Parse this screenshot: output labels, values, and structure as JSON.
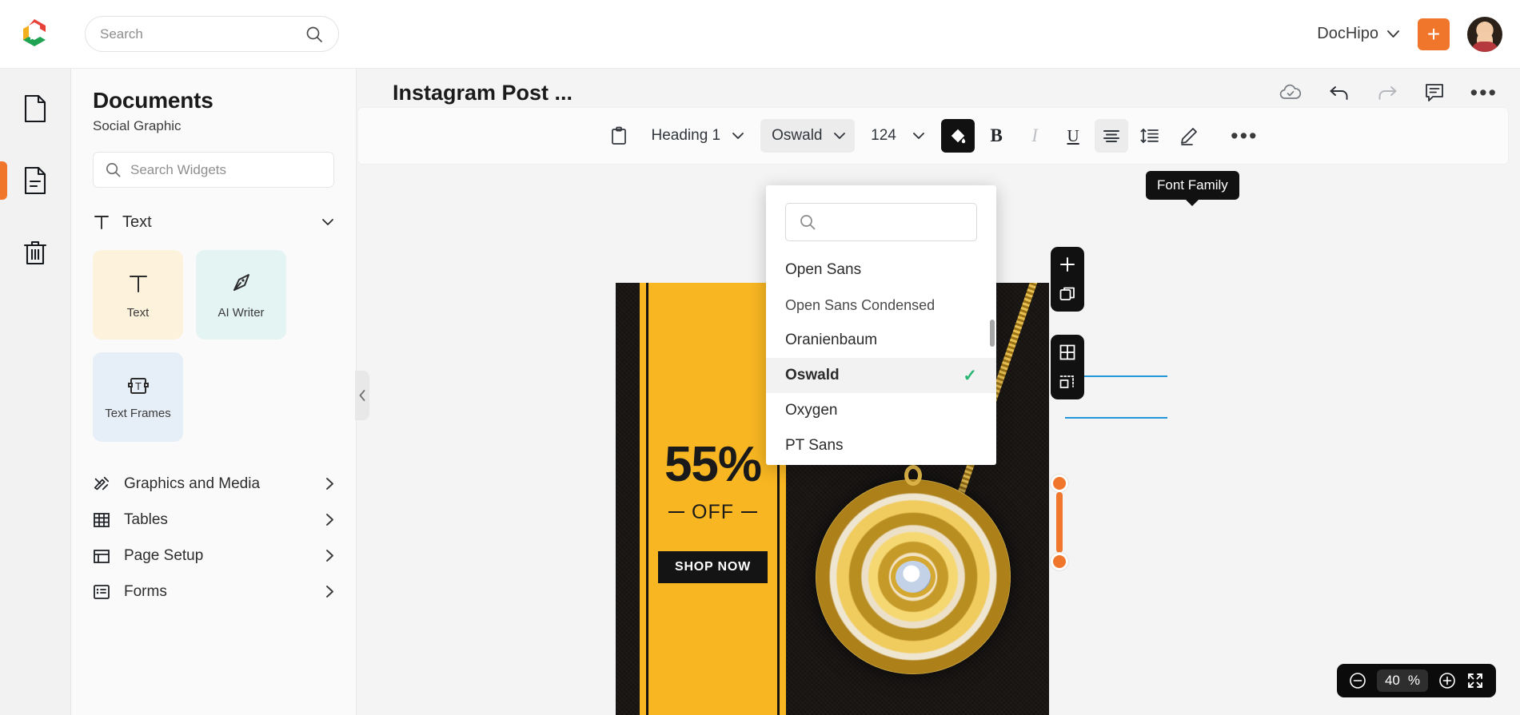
{
  "topbar": {
    "search_placeholder": "Search",
    "workspace": "DocHipo",
    "add_label": "+"
  },
  "rail": {
    "items": [
      {
        "name": "documents",
        "icon": "file-icon"
      },
      {
        "name": "templates",
        "icon": "file-lines-icon"
      },
      {
        "name": "trash",
        "icon": "trash-icon"
      }
    ]
  },
  "sidebar": {
    "title": "Documents",
    "subtitle": "Social Graphic",
    "search_placeholder": "Search Widgets",
    "section": {
      "label": "Text",
      "icon": "text-icon"
    },
    "cards": [
      {
        "label": "Text",
        "icon": "text-glyph-icon",
        "color": "#fdf3dd"
      },
      {
        "label": "AI Writer",
        "icon": "pen-nib-icon",
        "color": "#e4f4f2"
      },
      {
        "label": "Text Frames",
        "icon": "text-frame-icon",
        "color": "#e6eef7"
      }
    ],
    "menu": [
      {
        "label": "Graphics and Media",
        "icon": "graphics-media-icon"
      },
      {
        "label": "Tables",
        "icon": "table-icon"
      },
      {
        "label": "Page Setup",
        "icon": "page-setup-icon"
      },
      {
        "label": "Forms",
        "icon": "forms-icon"
      }
    ]
  },
  "document": {
    "title": "Instagram Post ...",
    "actions": [
      {
        "name": "cloud-saved-icon"
      },
      {
        "name": "undo-icon"
      },
      {
        "name": "redo-icon"
      },
      {
        "name": "comment-icon"
      },
      {
        "name": "more-options-icon"
      }
    ]
  },
  "toolbar": {
    "tooltip": "Font Family",
    "paste_icon": "clipboard-icon",
    "heading_style": "Heading 1",
    "font_family": "Oswald",
    "font_size": "124",
    "fill_icon": "paint-bucket-icon",
    "bold": "B",
    "italic": "I",
    "underline": "U",
    "align_icon": "align-center-icon",
    "line_height_icon": "line-height-icon",
    "highlighter_icon": "pencil-icon",
    "more_icon": "more-icon"
  },
  "font_dropdown": {
    "search_placeholder": "",
    "items": [
      {
        "label": "Open Sans",
        "selected": false
      },
      {
        "label": "Open Sans Condensed",
        "selected": false
      },
      {
        "label": "Oranienbaum",
        "selected": false
      },
      {
        "label": "Oswald",
        "selected": true
      },
      {
        "label": "Oxygen",
        "selected": false
      },
      {
        "label": "PT Sans",
        "selected": false
      }
    ],
    "check_mark": "✓"
  },
  "canvas": {
    "float_panel_top": [
      "add-page-icon",
      "duplicate-page-icon"
    ],
    "float_panel_bottom": [
      "grid-icon",
      "resize-icon"
    ],
    "design": {
      "percent": "55%",
      "off_label": "OFF",
      "cta": "SHOP NOW"
    }
  },
  "zoom": {
    "minus": "−",
    "value": "40",
    "unit": "%",
    "plus": "+",
    "fullscreen_icon": "fullscreen-icon"
  },
  "colors": {
    "accent": "#f0762b",
    "promo_yellow": "#f7b622",
    "check_green": "#2bb673",
    "guide_blue": "#2196d8"
  }
}
